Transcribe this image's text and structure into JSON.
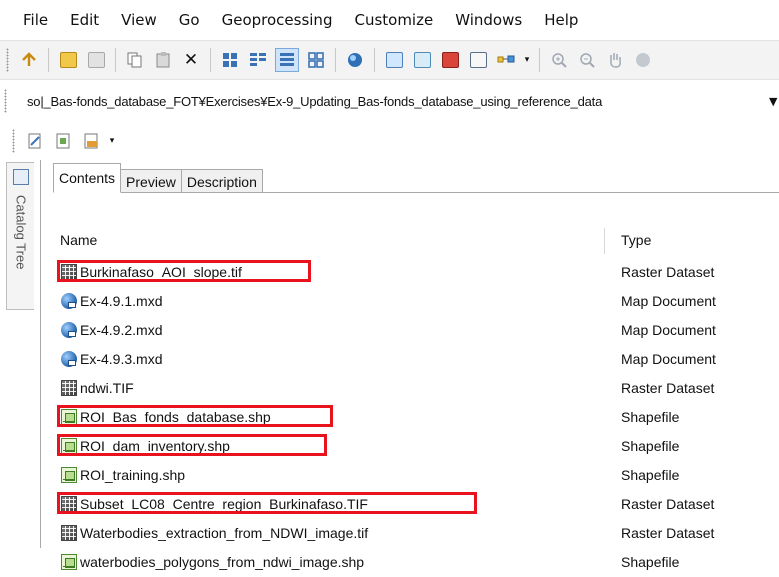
{
  "menu": [
    "File",
    "Edit",
    "View",
    "Go",
    "Geoprocessing",
    "Customize",
    "Windows",
    "Help"
  ],
  "toolbar": {
    "icons": [
      "up-one-level-icon",
      "connect-to-folder-icon",
      "disconnect-folder-icon",
      "copy-icon",
      "paste-icon",
      "delete-icon",
      "large-icons-view-icon",
      "list-view-icon",
      "details-view-icon",
      "thumbnails-view-icon",
      "launch-arcmap-icon",
      "catalog-tree-icon",
      "search-window-icon",
      "arctoolbox-icon",
      "python-window-icon",
      "model-builder-icon",
      "zoom-in-icon",
      "zoom-out-icon",
      "pan-icon",
      "full-extent-icon"
    ],
    "delete_glyph": "✕"
  },
  "address": {
    "path": "so|_Bas-fonds_database_FOT¥Exercises¥Ex-9_Updating_Bas-fonds_database_using_reference_data",
    "dropdown_glyph": "▼"
  },
  "catalog_tree_label": "Catalog Tree",
  "tabs": [
    {
      "label": "Contents",
      "active": true
    },
    {
      "label": "Preview",
      "active": false
    },
    {
      "label": "Description",
      "active": false
    }
  ],
  "columns": {
    "name": "Name",
    "type": "Type"
  },
  "files": [
    {
      "name": "Burkinafaso_AOI_slope.tif",
      "type": "Raster Dataset",
      "icon": "raster-icon",
      "highlighted": true
    },
    {
      "name": "Ex-4.9.1.mxd",
      "type": "Map Document",
      "icon": "map-document-icon",
      "highlighted": false
    },
    {
      "name": "Ex-4.9.2.mxd",
      "type": "Map Document",
      "icon": "map-document-icon",
      "highlighted": false
    },
    {
      "name": "Ex-4.9.3.mxd",
      "type": "Map Document",
      "icon": "map-document-icon",
      "highlighted": false
    },
    {
      "name": "ndwi.TIF",
      "type": "Raster Dataset",
      "icon": "raster-icon",
      "highlighted": false
    },
    {
      "name": "ROI_Bas_fonds_database.shp",
      "type": "Shapefile",
      "icon": "shapefile-icon",
      "highlighted": true
    },
    {
      "name": "ROI_dam_inventory.shp",
      "type": "Shapefile",
      "icon": "shapefile-icon",
      "highlighted": true
    },
    {
      "name": "ROI_training.shp",
      "type": "Shapefile",
      "icon": "shapefile-icon",
      "highlighted": false
    },
    {
      "name": "Subset_LC08_Centre_region_Burkinafaso.TIF",
      "type": "Raster Dataset",
      "icon": "raster-icon",
      "highlighted": true
    },
    {
      "name": "Waterbodies_extraction_from_NDWI_image.tif",
      "type": "Raster Dataset",
      "icon": "raster-icon",
      "highlighted": false
    },
    {
      "name": "waterbodies_polygons_from_ndwi_image.shp",
      "type": "Shapefile",
      "icon": "shapefile-icon",
      "highlighted": false
    }
  ],
  "colors": {
    "highlight": "#e8131d",
    "panel_border": "#a9a9a9"
  }
}
